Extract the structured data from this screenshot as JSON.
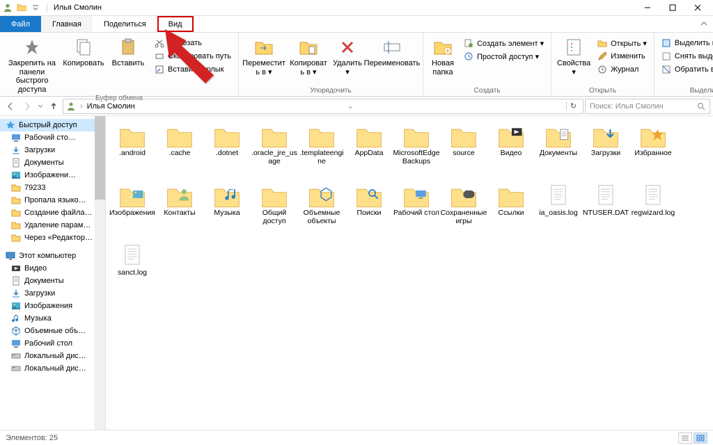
{
  "window": {
    "title": "Илья Смолин"
  },
  "tabs": {
    "file": "Файл",
    "home": "Главная",
    "share": "Поделиться",
    "view": "Вид"
  },
  "ribbon": {
    "clipboard": {
      "label": "Буфер обмена",
      "pin": "Закрепить на панели\nбыстрого доступа",
      "copy": "Копировать",
      "paste": "Вставить",
      "cut": "Вырезать",
      "copyPath": "Скопировать путь",
      "pasteShortcut": "Вставить ярлык"
    },
    "organize": {
      "label": "Упорядочить",
      "moveTo": "Переместит\nь в ▾",
      "copyTo": "Копироват\nь в ▾",
      "delete": "Удалить\n▾",
      "rename": "Переименовать"
    },
    "create": {
      "label": "Создать",
      "newFolder": "Новая\nпапка",
      "newItem": "Создать элемент ▾",
      "easyAccess": "Простой доступ ▾"
    },
    "open": {
      "label": "Открыть",
      "properties": "Свойства\n▾",
      "open": "Открыть ▾",
      "edit": "Изменить",
      "history": "Журнал"
    },
    "select": {
      "label": "Выделить",
      "selectAll": "Выделить все",
      "selectNone": "Снять выделение",
      "invert": "Обратить выделение"
    }
  },
  "nav": {
    "breadcrumb": [
      "Илья Смолин"
    ],
    "searchPlaceholder": "Поиск: Илья Смолин"
  },
  "tree": {
    "quickAccess": "Быстрый доступ",
    "items1": [
      "Рабочий сто…",
      "Загрузки",
      "Документы",
      "Изображени…",
      "79233",
      "Пропала языко…",
      "Создание файла…",
      "Удаление парам…",
      "Через «Редактор…"
    ],
    "thisPC": "Этот компьютер",
    "items2": [
      "Видео",
      "Документы",
      "Загрузки",
      "Изображения",
      "Музыка",
      "Объемные объ…",
      "Рабочий стол",
      "Локальный дис…",
      "Локальный дис…"
    ]
  },
  "files": [
    {
      "name": ".android",
      "type": "folder"
    },
    {
      "name": ".cache",
      "type": "folder"
    },
    {
      "name": ".dotnet",
      "type": "folder"
    },
    {
      "name": ".oracle_jre_usage",
      "type": "folder"
    },
    {
      "name": ".templateengine",
      "type": "folder"
    },
    {
      "name": "AppData",
      "type": "folder"
    },
    {
      "name": "MicrosoftEdgeBackups",
      "type": "folder"
    },
    {
      "name": "source",
      "type": "folder"
    },
    {
      "name": "Видео",
      "type": "folder-video"
    },
    {
      "name": "Документы",
      "type": "folder-docs"
    },
    {
      "name": "Загрузки",
      "type": "folder-down"
    },
    {
      "name": "Избранное",
      "type": "folder-star"
    },
    {
      "name": "Изображения",
      "type": "folder-pic"
    },
    {
      "name": "Контакты",
      "type": "folder-user"
    },
    {
      "name": "Музыка",
      "type": "folder-music"
    },
    {
      "name": "Общий доступ",
      "type": "folder"
    },
    {
      "name": "Объемные объекты",
      "type": "folder-3d"
    },
    {
      "name": "Поиски",
      "type": "folder-search"
    },
    {
      "name": "Рабочий стол",
      "type": "folder-desktop"
    },
    {
      "name": "Сохраненные игры",
      "type": "folder-games"
    },
    {
      "name": "Ссылки",
      "type": "folder"
    },
    {
      "name": "ia_oasis.log",
      "type": "file"
    },
    {
      "name": "NTUSER.DAT",
      "type": "file"
    },
    {
      "name": "regwizard.log",
      "type": "file"
    },
    {
      "name": "sanct.log",
      "type": "file"
    }
  ],
  "status": {
    "count": "Элементов: 25"
  }
}
